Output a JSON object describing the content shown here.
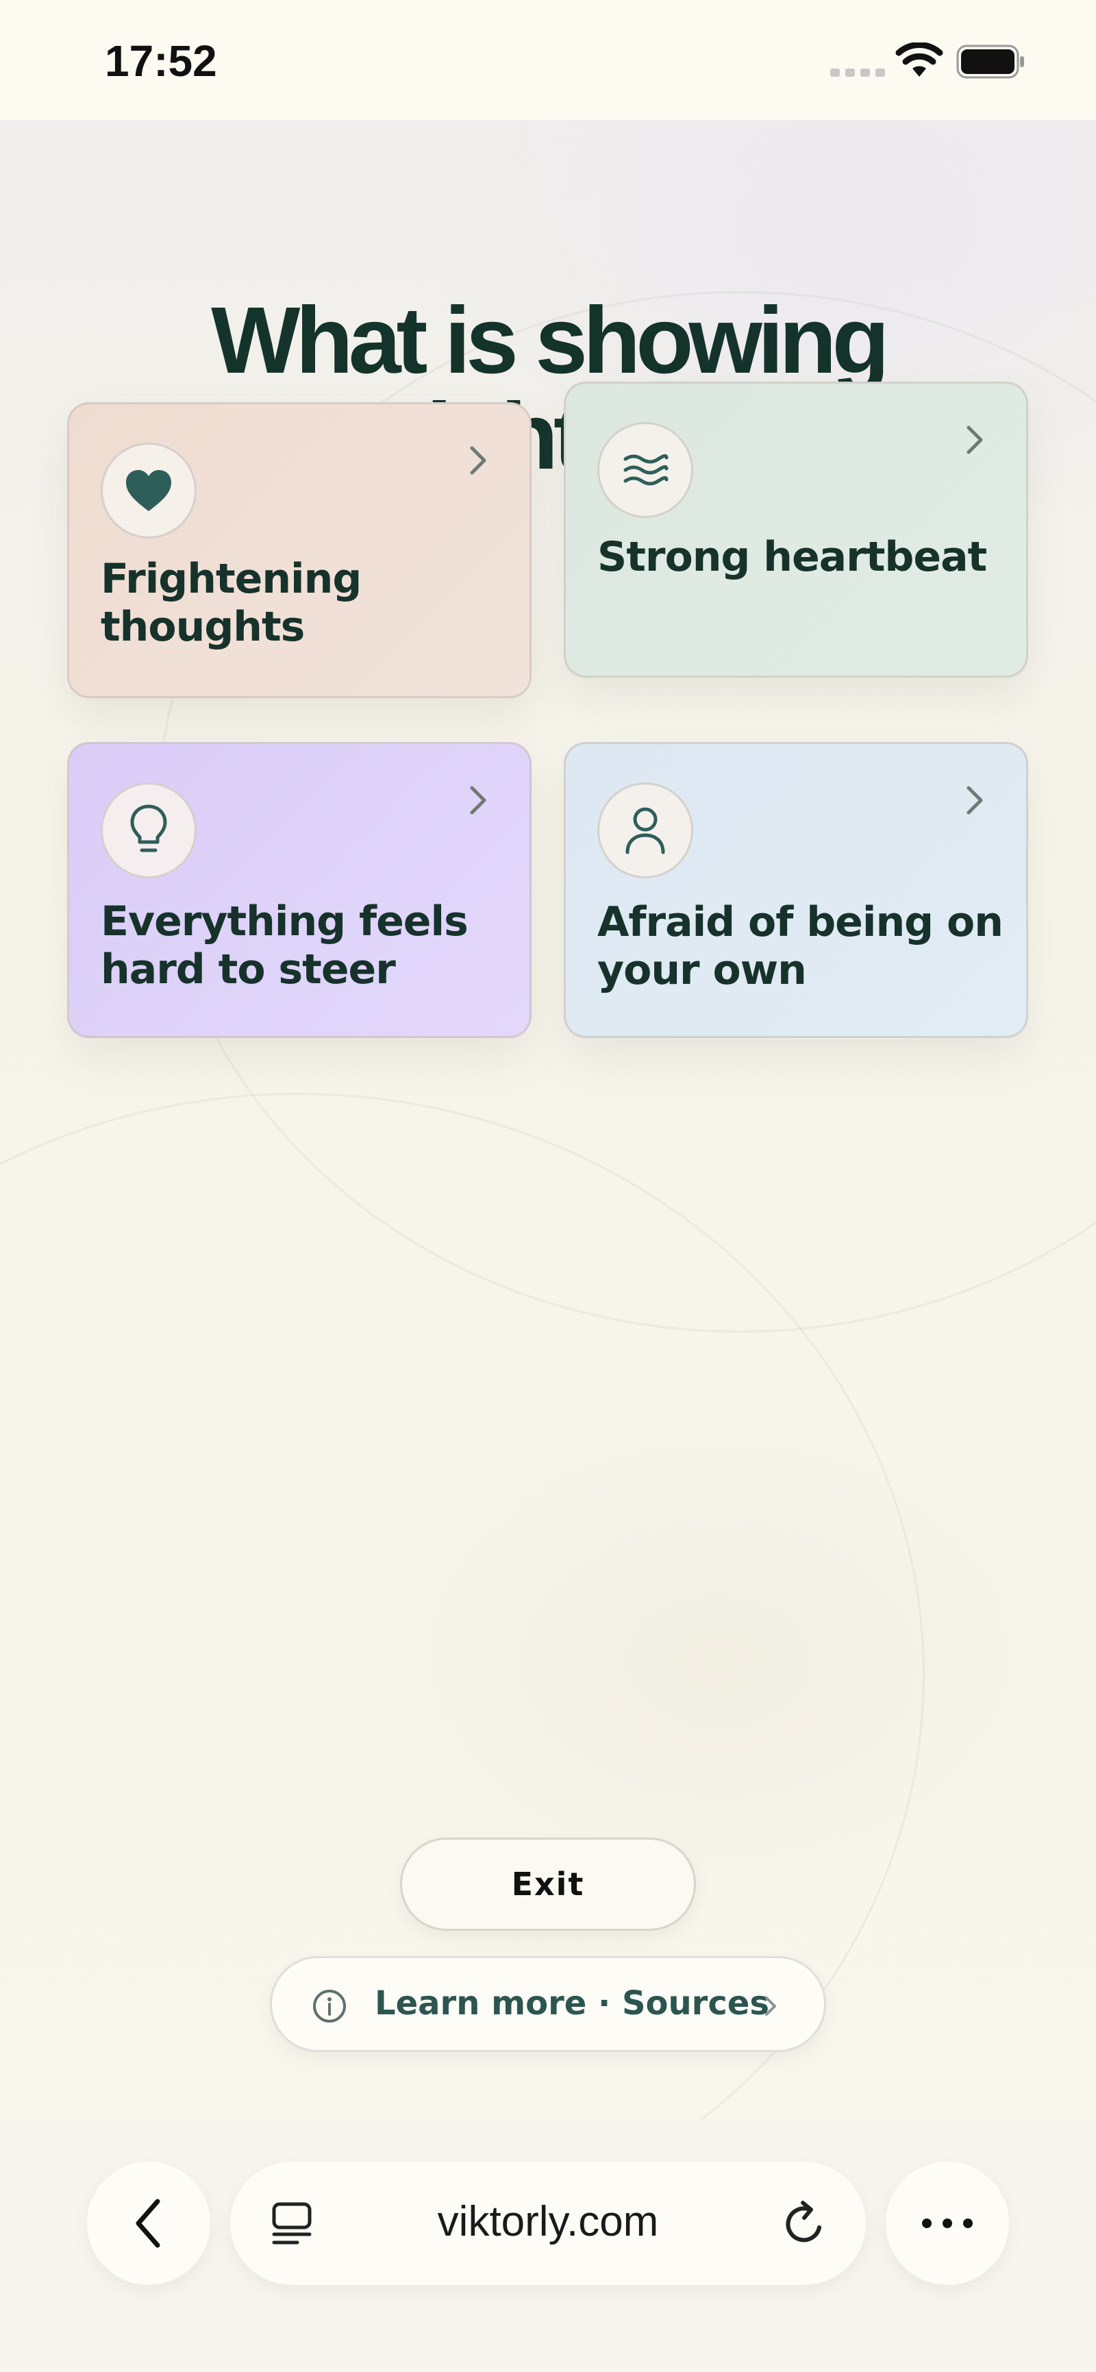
{
  "status_bar": {
    "time": "17:52"
  },
  "page": {
    "title_line1": "What is showing",
    "title_line2": "up right now?"
  },
  "cards": [
    {
      "label": "Frightening thoughts",
      "icon": "heart-icon",
      "color": "#efdfd5"
    },
    {
      "label": "Strong heartbeat",
      "icon": "waves-icon",
      "color": "#dde9e1"
    },
    {
      "label": "Everything feels hard to steer",
      "icon": "lightbulb-icon",
      "color": "#ddd3f7"
    },
    {
      "label": "Afraid of being on your own",
      "icon": "person-icon",
      "color": "#dfe9f2"
    }
  ],
  "actions": {
    "exit_label": "Exit",
    "learn_more_label": "Learn more · Sources"
  },
  "browser": {
    "url": "viktorly.com"
  },
  "colors": {
    "title": "#14332b",
    "accent_icon": "#2e5e5a",
    "learn_more_text": "#2c5550"
  }
}
